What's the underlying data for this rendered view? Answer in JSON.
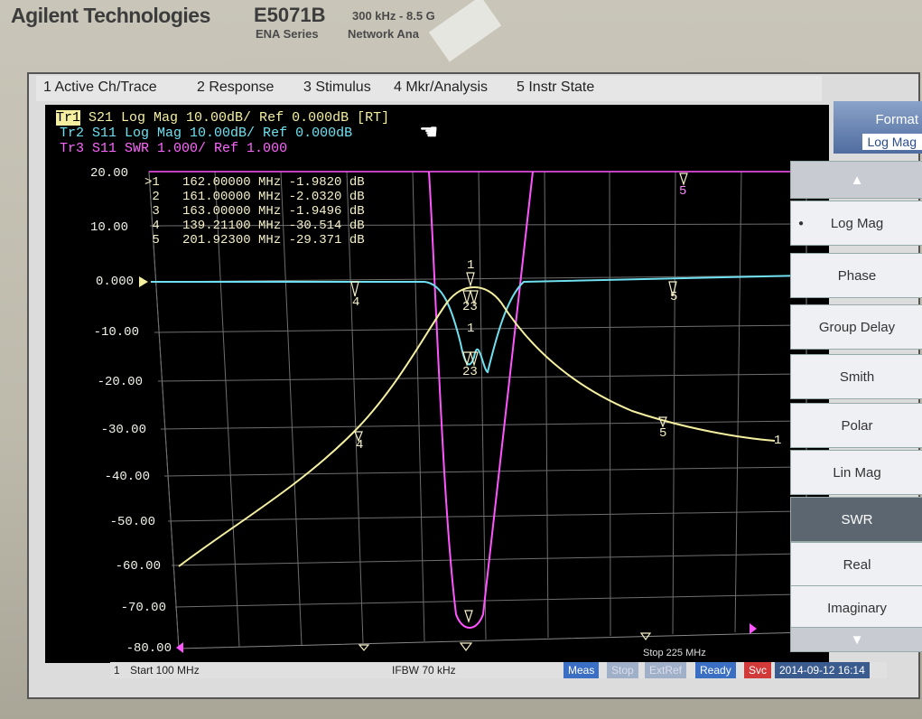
{
  "header": {
    "brand": "Agilent Technologies",
    "model": "E5071B",
    "series": "ENA Series",
    "spec": "300 kHz - 8.5 G",
    "spec_line2": "Network Ana"
  },
  "menu": [
    "1 Active Ch/Trace",
    "2 Response",
    "3 Stimulus",
    "4 Mkr/Analysis",
    "5 Instr State"
  ],
  "traces": [
    {
      "id": "Tr1",
      "text": "S21 Log Mag 10.00dB/ Ref 0.000dB [RT]",
      "color": "#f5f0a0"
    },
    {
      "id": "Tr2",
      "text": "S11 Log Mag 10.00dB/ Ref 0.000dB",
      "color": "#6fe0f0"
    },
    {
      "id": "Tr3",
      "text": "S11 SWR 1.000/ Ref 1.000",
      "color": "#ff66ff"
    }
  ],
  "y_labels": [
    "20.00",
    "10.00",
    "0.000",
    "-10.00",
    "-20.00",
    "-30.00",
    "-40.00",
    "-50.00",
    "-60.00",
    "-70.00",
    "-80.00"
  ],
  "markers": [
    ">1   162.00000 MHz -1.9820 dB",
    " 2   161.00000 MHz -2.0320 dB",
    " 3   163.00000 MHz -1.9496 dB",
    " 4   139.21100 MHz -30.514 dB",
    " 5   201.92300 MHz -29.371 dB"
  ],
  "softkeys": {
    "title": "Format",
    "current": "Log Mag",
    "items": [
      "Log Mag",
      "Phase",
      "Group Delay",
      "Smith",
      "Polar",
      "Lin Mag",
      "SWR",
      "Real",
      "Imaginary"
    ],
    "selected": "SWR"
  },
  "status": {
    "channel": "1",
    "start": "Start 100 MHz",
    "ifbw": "IFBW 70 kHz",
    "stop": "Stop 225 MHz",
    "meas": "Meas",
    "stop_btn": "Stop",
    "extref": "ExtRef",
    "ready": "Ready",
    "svc": "Svc",
    "datetime": "2014-09-12 16:14"
  },
  "colors": {
    "s21": "#f5f0a0",
    "s11": "#6fe0f0",
    "swr": "#ff55ff",
    "grid": "#6e6e6e"
  }
}
